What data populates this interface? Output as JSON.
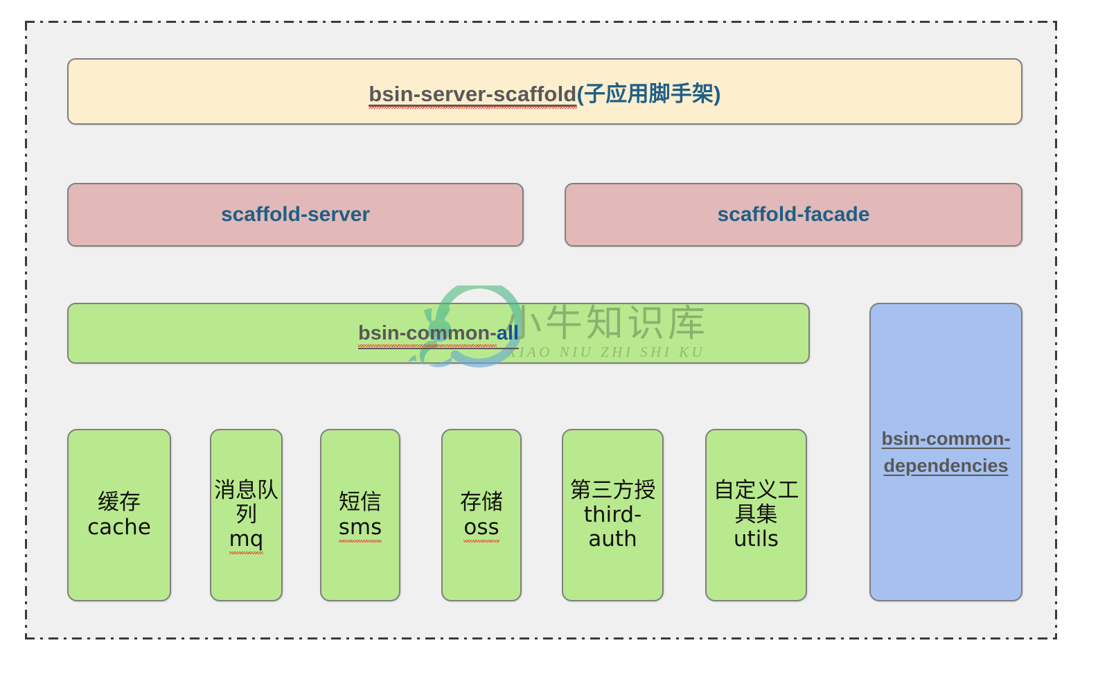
{
  "diagram": {
    "title_box": {
      "name_text": "bsin-server-scaffold",
      "paren_text": "(子应用脚手架)"
    },
    "middle_row": [
      {
        "label": "scaffold-server"
      },
      {
        "label": "scaffold-facade"
      }
    ],
    "common_bar": {
      "prefix": "bsin-common-",
      "suffix": "all"
    },
    "dependencies_box": {
      "label": "bsin-common-dependencies"
    },
    "modules": [
      {
        "cn": "缓存",
        "en": "cache",
        "spell": false
      },
      {
        "cn": "消息队列",
        "en": "mq",
        "spell": true
      },
      {
        "cn": "短信",
        "en": "sms",
        "spell": true
      },
      {
        "cn": "存储",
        "en": "oss",
        "spell": true
      },
      {
        "cn": "第三方授",
        "en": "third-auth",
        "spell": false
      },
      {
        "cn": "自定义工具集",
        "en": "utils",
        "spell": false
      }
    ],
    "watermark": {
      "text": "小牛知识库",
      "subtext": "XIAO NIU ZHI SHI KU"
    },
    "colors": {
      "scaffold_fill": "#fdeecd",
      "pink_fill": "#e2b9b8",
      "green_fill": "#b9e98e",
      "blue_fill": "#a6c1f0",
      "canvas_fill": "#f0f0f0",
      "border": "#7f7f7f",
      "label_gray": "#585858",
      "label_blue": "#1f5f86",
      "spell_red": "#e8302b"
    }
  }
}
